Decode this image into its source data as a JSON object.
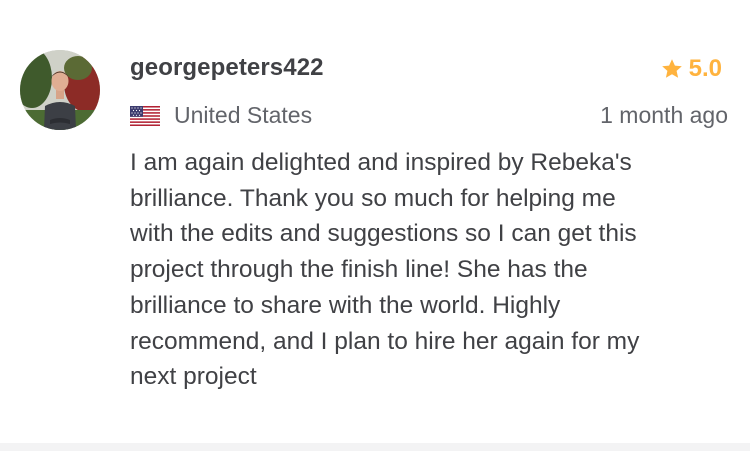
{
  "review": {
    "username": "georgepeters422",
    "rating": "5.0",
    "country": "United States",
    "time_ago": "1 month ago",
    "text_lines": [
      "I am again delighted and inspired by Rebeka's",
      "brilliance. Thank you so much for helping me",
      "with the edits and suggestions so I can get this",
      "project through the finish line!  She has the",
      "brilliance to share with the world. Highly",
      "recommend, and I plan to hire her again for my",
      "next project"
    ]
  },
  "icons": {
    "rating": "star-icon",
    "country": "us-flag-icon",
    "avatar": "profile-photo"
  },
  "colors": {
    "star": "#ffb33e",
    "username": "#404145",
    "muted_text": "#62646a",
    "body_text": "#404145"
  }
}
